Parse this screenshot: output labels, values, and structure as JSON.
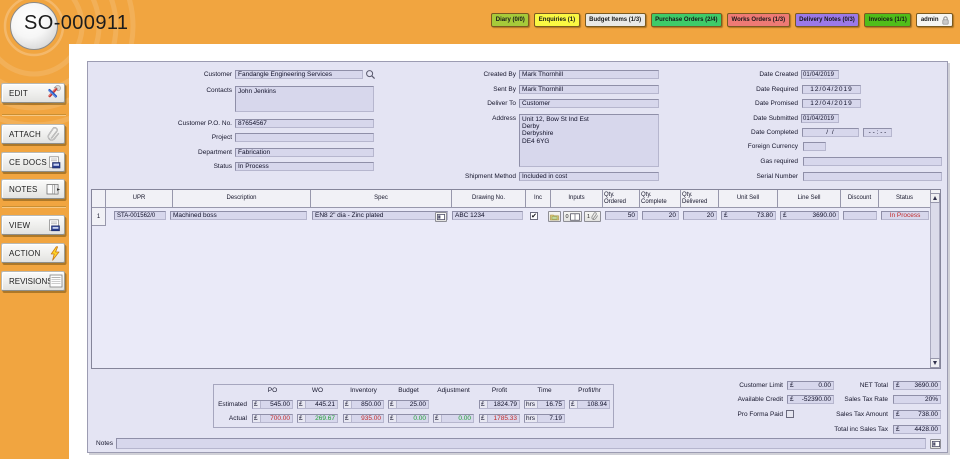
{
  "window": {
    "title": "SO-000911"
  },
  "topbar": {
    "buttons": [
      {
        "label": "Diary (0/0)",
        "bg": "#A6CA3A"
      },
      {
        "label": "Enquiries (1)",
        "bg": "#FAF843"
      },
      {
        "label": "Budget Items (1/3)",
        "bg": "#E9E9E6"
      },
      {
        "label": "Purchase Orders (2/4)",
        "bg": "#3ECB69"
      },
      {
        "label": "Works Orders (1/3)",
        "bg": "#EE7A75"
      },
      {
        "label": "Delivery Notes (0/3)",
        "bg": "#9B79E9"
      },
      {
        "label": "Invoices (1/1)",
        "bg": "#50BD1A"
      },
      {
        "label": "admin",
        "bg": "#F5F5F2"
      }
    ]
  },
  "sidebar": {
    "buttons": [
      {
        "label": "EDIT"
      },
      {
        "label": "ATTACH"
      },
      {
        "label": "CE DOCS"
      },
      {
        "label": "NOTES"
      },
      {
        "label": "VIEW"
      },
      {
        "label": "ACTION"
      },
      {
        "label": "REVISIONS"
      }
    ]
  },
  "form": {
    "customer": {
      "label": "Customer",
      "value": "Fandangle Engineering Services"
    },
    "contacts": {
      "label": "Contacts",
      "value": "John Jenkins"
    },
    "customer_po_no": {
      "label": "Customer P.O. No.",
      "value": "87654567"
    },
    "project": {
      "label": "Project",
      "value": ""
    },
    "department": {
      "label": "Department",
      "value": "Fabrication"
    },
    "status": {
      "label": "Status",
      "value": "In Process"
    },
    "created_by": {
      "label": "Created By",
      "value": "Mark Thornhill"
    },
    "sent_by": {
      "label": "Sent By",
      "value": "Mark Thornhill"
    },
    "deliver_to": {
      "label": "Deliver To",
      "value": "Customer"
    },
    "address": {
      "label": "Address",
      "value": "Unit 12, Bow St Ind Est\nDerby\nDerbyshire\nDE4 6YG"
    },
    "shipment_method": {
      "label": "Shipment Method",
      "value": "Included in cost"
    },
    "date_created": {
      "label": "Date Created",
      "value": "01/04/2019"
    },
    "date_required": {
      "label": "Date Required",
      "value": "12/04/2019"
    },
    "date_promised": {
      "label": "Date Promised",
      "value": "12/04/2019"
    },
    "date_submitted": {
      "label": "Date Submitted",
      "value": "01/04/2019"
    },
    "date_completed": {
      "label": "Date Completed",
      "value": "/    /",
      "time_value": "- - : - -"
    },
    "foreign_currency": {
      "label": "Foreign Currency",
      "value": ""
    },
    "gas_required": {
      "label": "Gas required",
      "value": ""
    },
    "serial_number": {
      "label": "Serial Number",
      "value": ""
    }
  },
  "items_table": {
    "headers": [
      "",
      "UPR",
      "Description",
      "Spec",
      "Drawing No.",
      "Inc",
      "Inputs",
      "Qty. Ordered",
      "Qty. Complete",
      "Qty. Delivered",
      "Unit Sell",
      "Line Sell",
      "Discount",
      "Status"
    ],
    "rows": [
      {
        "num": "1",
        "upr": "STA-001562/0",
        "description": "Machined boss",
        "spec": "EN8 2\" dia - Zinc plated",
        "drawing_no": "ABC 1234",
        "inc_checked": "✔",
        "inputs_docs_count": "0",
        "inputs_attachments_count": "1",
        "qty_ordered": "50",
        "qty_complete": "20",
        "qty_delivered": "20",
        "currency": "£",
        "unit_sell": "73.80",
        "line_sell": "3690.00",
        "discount": "",
        "status": "In Process"
      }
    ]
  },
  "summary": {
    "columns": [
      "PO",
      "WO",
      "Inventory",
      "Budget",
      "Adjustment",
      "Profit",
      "Time",
      "Profit/hr"
    ],
    "currency_prefix": "£",
    "time_prefix": "hrs",
    "estimated": {
      "label": "Estimated",
      "po": "545.00",
      "wo": "445.21",
      "inventory": "850.00",
      "budget": "25.00",
      "profit": "1824.79",
      "time": "16.75",
      "profit_per_hr": "108.94"
    },
    "actual": {
      "label": "Actual",
      "po": "700.00",
      "wo": "269.67",
      "inventory": "935.00",
      "budget": "0.00",
      "adjustment": "0.00",
      "profit": "1785.33",
      "time": "7.19"
    }
  },
  "totals": {
    "customer_limit": {
      "label": "Customer Limit",
      "currency": "£",
      "value": "0.00"
    },
    "available_credit": {
      "label": "Available Credit",
      "currency": "£",
      "value": "-52390.00"
    },
    "pro_forma_paid": {
      "label": "Pro Forma Paid"
    },
    "net_total": {
      "label": "NET Total",
      "currency": "£",
      "value": "3690.00"
    },
    "sales_tax_rate": {
      "label": "Sales Tax  Rate",
      "value": "20%"
    },
    "sales_tax_amount": {
      "label": "Sales Tax  Amount",
      "currency": "£",
      "value": "738.00"
    },
    "total_inc_sales_tax": {
      "label": "Total inc Sales Tax",
      "currency": "£",
      "value": "4428.00"
    }
  },
  "notes": {
    "label": "Notes",
    "value": ""
  },
  "colors": {
    "accent_orange": "#F1A540",
    "panel": "#E4E4F3",
    "field": "#D7D7EC",
    "negative": "#C22A2A",
    "positive": "#1E9E33",
    "status_in_process": "#C22A2A"
  }
}
